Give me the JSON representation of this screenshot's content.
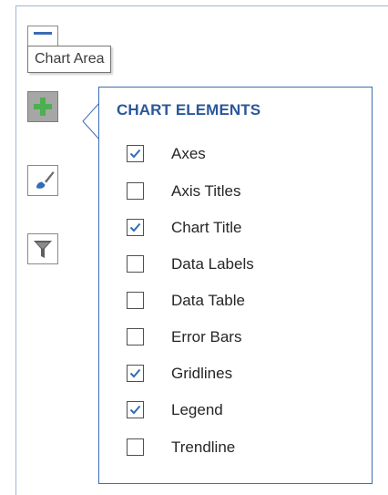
{
  "tooltip": {
    "text": "Chart Area"
  },
  "side_buttons": [
    {
      "name": "chart-elements",
      "icon": "plus-icon",
      "active": true
    },
    {
      "name": "chart-styles",
      "icon": "paintbrush-icon",
      "active": false
    },
    {
      "name": "chart-filters",
      "icon": "filter-icon",
      "active": false
    }
  ],
  "panel": {
    "title": "CHART ELEMENTS",
    "items": [
      {
        "label": "Axes",
        "checked": true
      },
      {
        "label": "Axis Titles",
        "checked": false
      },
      {
        "label": "Chart Title",
        "checked": true
      },
      {
        "label": "Data Labels",
        "checked": false
      },
      {
        "label": "Data Table",
        "checked": false
      },
      {
        "label": "Error Bars",
        "checked": false
      },
      {
        "label": "Gridlines",
        "checked": true
      },
      {
        "label": "Legend",
        "checked": true
      },
      {
        "label": "Trendline",
        "checked": false
      }
    ]
  },
  "colors": {
    "accent": "#2b579a",
    "panel_border": "#3c6db3",
    "plus_green": "#4caf50",
    "check_blue": "#2f6db8"
  }
}
